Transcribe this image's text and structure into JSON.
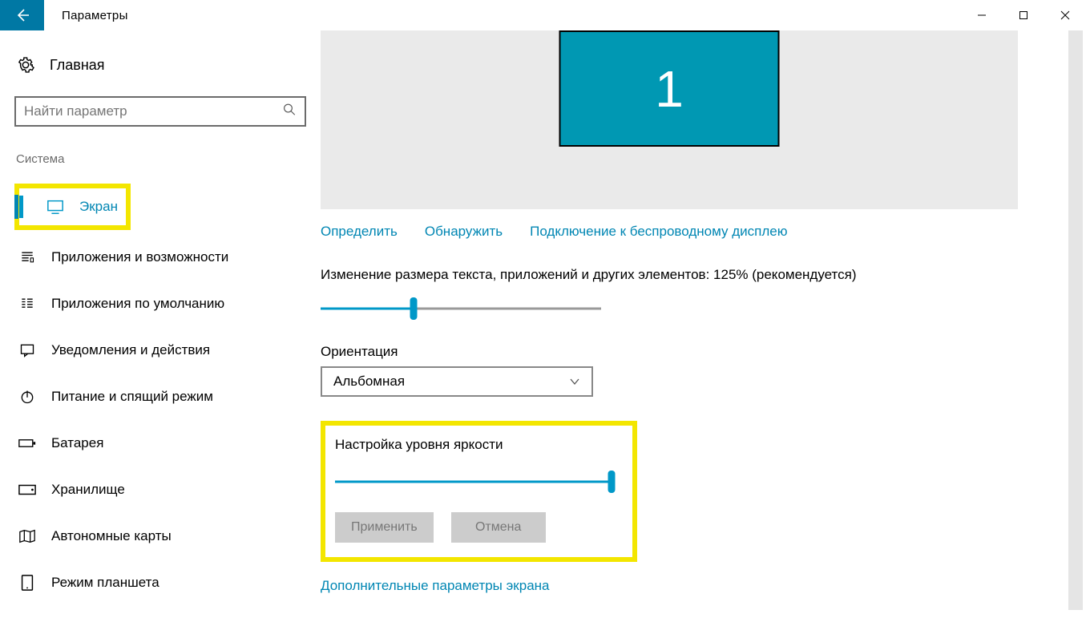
{
  "titlebar": {
    "title": "Параметры"
  },
  "sidebar": {
    "home": "Главная",
    "search_placeholder": "Найти параметр",
    "section": "Система",
    "items": {
      "display": "Экран",
      "apps": "Приложения и возможности",
      "defaults": "Приложения по умолчанию",
      "notifications": "Уведомления и действия",
      "power": "Питание и спящий режим",
      "battery": "Батарея",
      "storage": "Хранилище",
      "maps": "Автономные карты",
      "tablet": "Режим планшета"
    }
  },
  "main": {
    "monitor_number": "1",
    "links": {
      "identify": "Определить",
      "detect": "Обнаружить",
      "wireless": "Подключение к беспроводному дисплею"
    },
    "scale_label": "Изменение размера текста, приложений и других элементов: 125% (рекомендуется)",
    "scale_percent": 33,
    "orientation_label": "Ориентация",
    "orientation_value": "Альбомная",
    "brightness_label": "Настройка уровня яркости",
    "brightness_percent": 100,
    "apply_btn": "Применить",
    "cancel_btn": "Отмена",
    "advanced_link": "Дополнительные параметры экрана"
  }
}
